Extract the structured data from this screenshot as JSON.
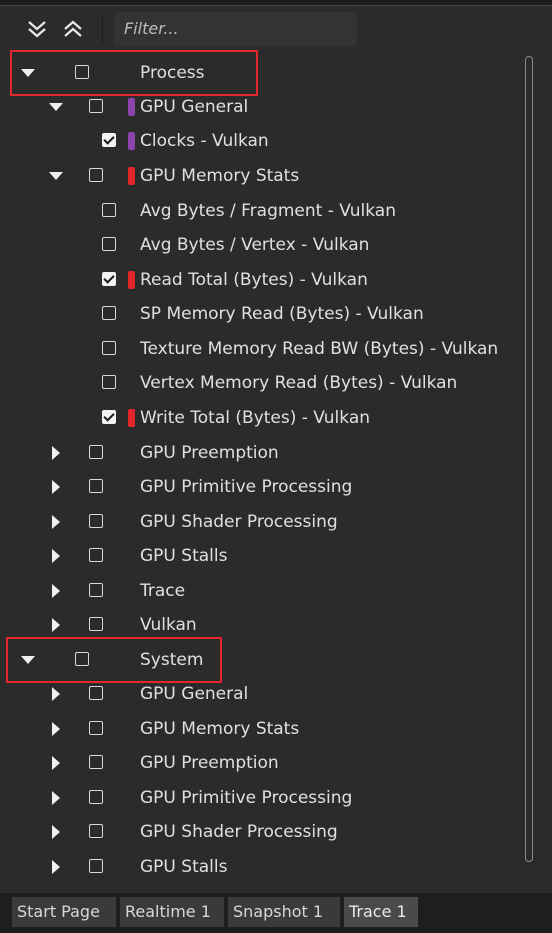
{
  "toolbar": {
    "expand_all_icon": "double-chevron-down-icon",
    "collapse_all_icon": "double-chevron-up-icon",
    "filter_placeholder": "Filter..."
  },
  "tree": {
    "process": {
      "label": "Process",
      "gpu_general": "GPU General",
      "clocks": "Clocks - Vulkan",
      "gpu_memory_stats": "GPU Memory Stats",
      "avg_bytes_fragment": "Avg Bytes / Fragment - Vulkan",
      "avg_bytes_vertex": "Avg Bytes / Vertex - Vulkan",
      "read_total": "Read Total (Bytes) - Vulkan",
      "sp_memory_read": "SP Memory Read (Bytes) - Vulkan",
      "texture_memory_read": "Texture Memory Read BW (Bytes) - Vulkan",
      "vertex_memory_read": "Vertex Memory Read (Bytes) - Vulkan",
      "write_total": "Write Total (Bytes) - Vulkan",
      "gpu_preemption": "GPU Preemption",
      "gpu_primitive_processing": "GPU Primitive Processing",
      "gpu_shader_processing": "GPU Shader Processing",
      "gpu_stalls": "GPU Stalls",
      "trace": "Trace",
      "vulkan": "Vulkan"
    },
    "system": {
      "label": "System",
      "gpu_general": "GPU General",
      "gpu_memory_stats": "GPU Memory Stats",
      "gpu_preemption": "GPU Preemption",
      "gpu_primitive_processing": "GPU Primitive Processing",
      "gpu_shader_processing": "GPU Shader Processing",
      "gpu_stalls": "GPU Stalls"
    }
  },
  "colors": {
    "purple_marker": "#8e44ad",
    "red_marker": "#e3262b",
    "highlight": "#e0282d"
  },
  "tabs": {
    "start_page": "Start Page",
    "realtime": "Realtime 1",
    "snapshot": "Snapshot 1",
    "trace": "Trace 1"
  }
}
